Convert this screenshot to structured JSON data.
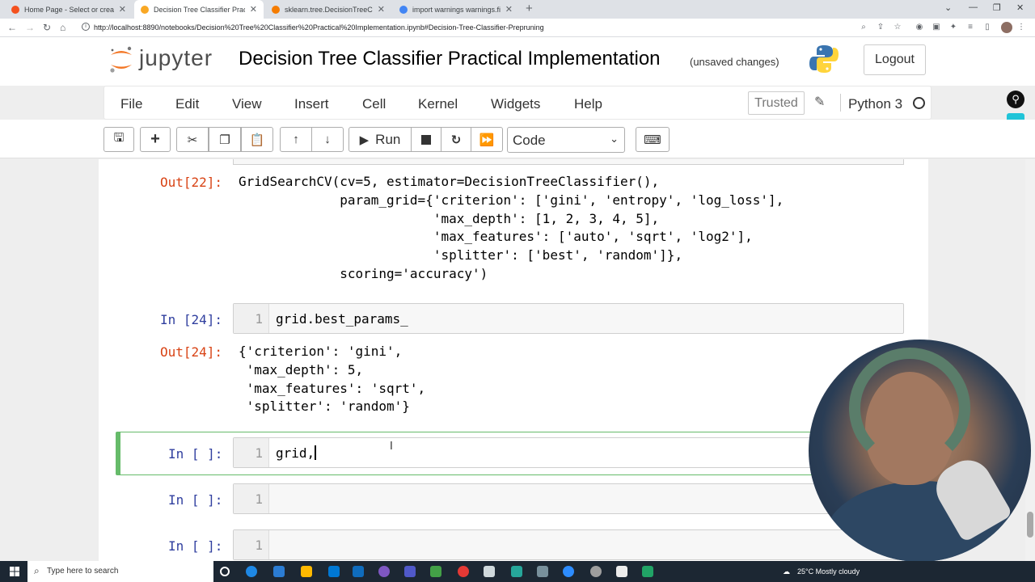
{
  "browser": {
    "tabs": [
      {
        "title": "Home Page - Select or create a n",
        "color": "#f4511e"
      },
      {
        "title": "Decision Tree Classifier Practical I",
        "color": "#f9a825"
      },
      {
        "title": "sklearn.tree.DecisionTreeClassifie",
        "color": "#f57c00"
      },
      {
        "title": "import warnings warnings.filterw",
        "color": "#4285f4"
      }
    ],
    "url": "http://localhost:8890/notebooks/Decision%20Tree%20Classifier%20Practical%20Implementation.ipynb#Decision-Tree-Classifier-Prepruning"
  },
  "jupyter": {
    "logo_text": "jupyter",
    "notebook_title": "Decision Tree Classifier Practical Implementation",
    "save_status": "(unsaved changes)",
    "logout_label": "Logout"
  },
  "menu": {
    "items": [
      "File",
      "Edit",
      "View",
      "Insert",
      "Cell",
      "Kernel",
      "Widgets",
      "Help"
    ],
    "trusted_label": "Trusted",
    "kernel_name": "Python 3"
  },
  "toolbar": {
    "run_label": "Run",
    "cell_type": "Code"
  },
  "cells": {
    "out22": {
      "prompt": "Out[22]:",
      "lines": [
        "GridSearchCV(cv=5, estimator=DecisionTreeClassifier(),",
        "             param_grid={'criterion': ['gini', 'entropy', 'log_loss'],",
        "                         'max_depth': [1, 2, 3, 4, 5],",
        "                         'max_features': ['auto', 'sqrt', 'log2'],",
        "                         'splitter': ['best', 'random']},",
        "             scoring='accuracy')"
      ]
    },
    "in24": {
      "prompt": "In [24]:",
      "line_no": "1",
      "code": "grid.best_params_"
    },
    "out24": {
      "prompt": "Out[24]:",
      "lines": [
        "{'criterion': 'gini',",
        " 'max_depth': 5,",
        " 'max_features': 'sqrt',",
        " 'splitter': 'random'}"
      ]
    },
    "in_active": {
      "prompt": "In [ ]:",
      "line_no": "1",
      "code": "grid,"
    },
    "in_empty1": {
      "prompt": "In [ ]:",
      "line_no": "1"
    },
    "in_empty2": {
      "prompt": "In [ ]:",
      "line_no": "1"
    }
  },
  "taskbar": {
    "search_placeholder": "Type here to search",
    "weather": "25°C  Mostly cloudy"
  },
  "colors": {
    "selected_cell_border": "#66bb6a",
    "out_prompt": "#d84315",
    "in_prompt": "#303f9f"
  }
}
